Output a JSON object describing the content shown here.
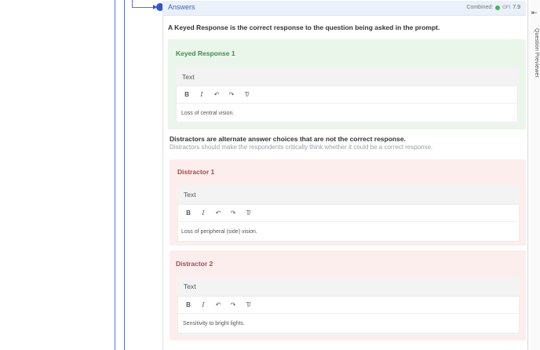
{
  "answers": {
    "title": "Answers",
    "combined_label": "Combined:",
    "gfi_label": "GFI",
    "gfi_score": "7.9",
    "status_color": "#3cba54"
  },
  "intro_text": "A Keyed Response is the correct response to the question being asked in the prompt.",
  "keyed_response": {
    "title": "Keyed Response 1",
    "field_label": "Text",
    "content": "Loss of central vision."
  },
  "toolbar": {
    "bold_icon": "B",
    "italic_icon": "I",
    "undo_icon": "↶",
    "redo_icon": "↷",
    "clear_format_icon": "T̸"
  },
  "distractors_heading": "Distractors are alternate answer choices that are not the correct response.",
  "distractors_subtext": "Distractors should make the respondents critically think whether it could be a correct response.",
  "distractors": [
    {
      "title": "Distractor 1",
      "field_label": "Text",
      "content": "Loss of peripheral (side) vision."
    },
    {
      "title": "Distractor 2",
      "field_label": "Text",
      "content": "Sensitivity to bright lights."
    }
  ],
  "previewer": {
    "label": "Question Previewer",
    "collapse_icon": "⇤"
  }
}
